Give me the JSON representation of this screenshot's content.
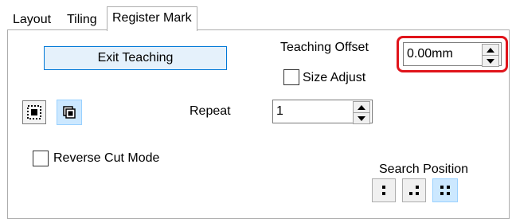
{
  "tabs": [
    {
      "label": "Layout"
    },
    {
      "label": "Tiling"
    },
    {
      "label": "Register Mark"
    }
  ],
  "exit_teaching_label": "Exit Teaching",
  "teaching_offset": {
    "label": "Teaching Offset",
    "value": "0.00mm"
  },
  "size_adjust_label": "Size Adjust",
  "repeat": {
    "label": "Repeat",
    "value": "1"
  },
  "reverse_cut_label": "Reverse Cut Mode",
  "search_position": {
    "label": "Search Position",
    "selected": "four-point"
  },
  "highlight_color": "#e0141b",
  "accent_color": "#0078d7"
}
